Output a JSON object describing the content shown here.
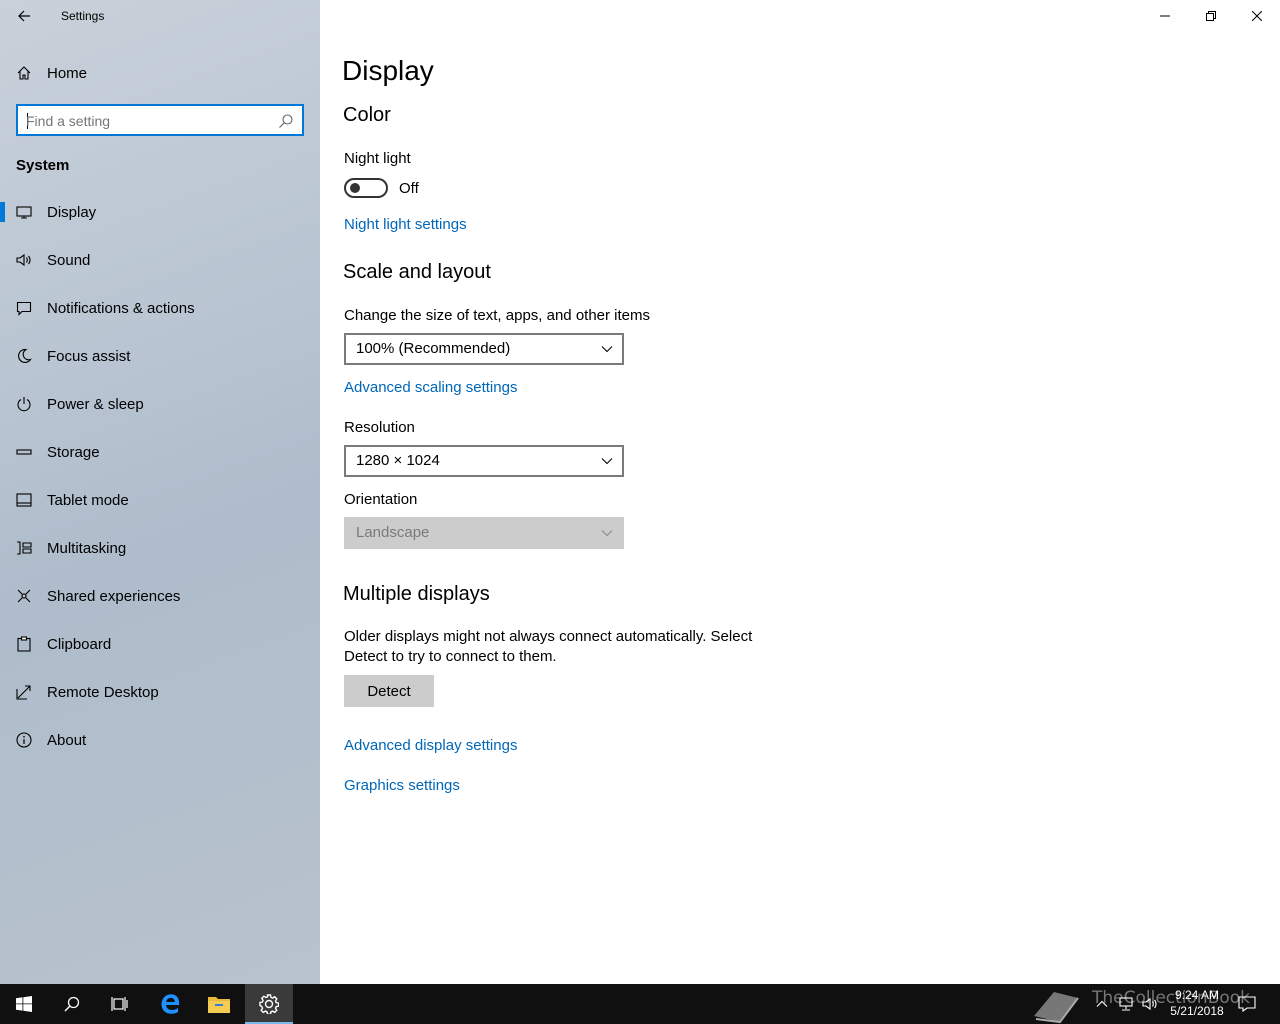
{
  "window": {
    "app_title": "Settings",
    "accent_color": "#0078d7",
    "link_color": "#0067b8"
  },
  "sidebar": {
    "home_label": "Home",
    "search_placeholder": "Find a setting",
    "section_label": "System",
    "items": [
      {
        "label": "Display",
        "icon": "display-icon",
        "selected": true
      },
      {
        "label": "Sound",
        "icon": "sound-icon"
      },
      {
        "label": "Notifications & actions",
        "icon": "notifications-icon"
      },
      {
        "label": "Focus assist",
        "icon": "moon-icon"
      },
      {
        "label": "Power & sleep",
        "icon": "power-icon"
      },
      {
        "label": "Storage",
        "icon": "storage-icon"
      },
      {
        "label": "Tablet mode",
        "icon": "tablet-mode-icon"
      },
      {
        "label": "Multitasking",
        "icon": "multitasking-icon"
      },
      {
        "label": "Shared experiences",
        "icon": "shared-experiences-icon"
      },
      {
        "label": "Clipboard",
        "icon": "clipboard-icon"
      },
      {
        "label": "Remote Desktop",
        "icon": "remote-desktop-icon"
      },
      {
        "label": "About",
        "icon": "info-icon"
      }
    ]
  },
  "main": {
    "title": "Display",
    "color": {
      "heading": "Color",
      "night_light_label": "Night light",
      "night_light_state": "Off",
      "night_light_settings_link": "Night light settings"
    },
    "scale": {
      "heading": "Scale and layout",
      "size_label": "Change the size of text, apps, and other items",
      "size_value": "100% (Recommended)",
      "advanced_scaling_link": "Advanced scaling settings",
      "resolution_label": "Resolution",
      "resolution_value": "1280 × 1024",
      "orientation_label": "Orientation",
      "orientation_value": "Landscape"
    },
    "multiple": {
      "heading": "Multiple displays",
      "description": "Older displays might not always connect automatically. Select Detect to try to connect to them.",
      "detect_label": "Detect",
      "advanced_display_link": "Advanced display settings",
      "graphics_link": "Graphics settings"
    }
  },
  "taskbar": {
    "time": "9:24 AM",
    "date": "5/21/2018",
    "watermark_text": "TheCollectionBook",
    "apps": [
      "start-icon",
      "search-icon",
      "task-view-icon",
      "edge-icon",
      "file-explorer-icon",
      "settings-gear-icon"
    ]
  }
}
